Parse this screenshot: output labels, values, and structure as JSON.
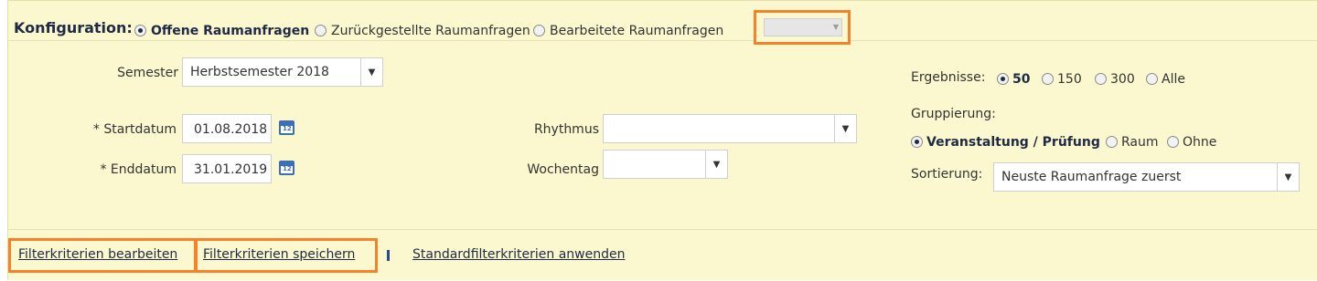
{
  "config": {
    "title": "Konfiguration:",
    "options": [
      {
        "label": "Offene Raumanfragen",
        "checked": true
      },
      {
        "label": "Zurückgestellte Raumanfragen",
        "checked": false
      },
      {
        "label": "Bearbeitete Raumanfragen",
        "checked": false
      }
    ],
    "extra_select_value": ""
  },
  "filters": {
    "semester_label": "Semester",
    "semester_value": "Herbstsemester 2018",
    "start_label": "* Startdatum",
    "start_value": "01.08.2018",
    "end_label": "* Enddatum",
    "end_value": "31.01.2019",
    "rhythm_label": "Rhythmus",
    "rhythm_value": "",
    "weekday_label": "Wochentag",
    "weekday_value": "",
    "calendar_icon_text": "12"
  },
  "results": {
    "label": "Ergebnisse:",
    "options": [
      {
        "label": "50",
        "checked": true
      },
      {
        "label": "150",
        "checked": false
      },
      {
        "label": "300",
        "checked": false
      },
      {
        "label": "Alle",
        "checked": false
      }
    ]
  },
  "grouping": {
    "label": "Gruppierung:",
    "options": [
      {
        "label": "Veranstaltung / Prüfung",
        "checked": true
      },
      {
        "label": "Raum",
        "checked": false
      },
      {
        "label": "Ohne",
        "checked": false
      }
    ]
  },
  "sorting": {
    "label": "Sortierung:",
    "value": "Neuste Raumanfrage zuerst"
  },
  "links": {
    "edit": "Filterkriterien bearbeiten",
    "save": "Filterkriterien speichern",
    "apply_default": "Standardfilterkriterien anwenden"
  },
  "colors": {
    "panel_bg": "#fbf8cf",
    "highlight": "#f5822a",
    "link": "#1f2a44",
    "icon_blue": "#3b6fb6"
  }
}
